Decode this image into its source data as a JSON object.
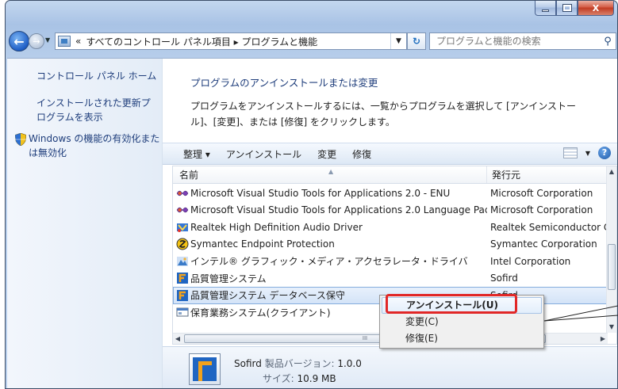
{
  "window": {
    "caption_buttons": {
      "minimize": "",
      "maximize": "",
      "close": "X"
    }
  },
  "nav": {
    "address_chevron": "«",
    "address_path": "すべてのコントロール パネル項目 ▸ プログラムと機能",
    "search_placeholder": "プログラムと機能の検索"
  },
  "left_pane": {
    "links": [
      "コントロール パネル ホーム",
      "インストールされた更新プログラムを表示",
      "Windows の機能の有効化または無効化"
    ]
  },
  "main": {
    "heading": "プログラムのアンインストールまたは変更",
    "description": "プログラムをアンインストールするには、一覧からプログラムを選択して [アンインストール]、[変更]、または [修復] をクリックします。"
  },
  "toolbar": {
    "organize": "整理 ▾",
    "uninstall": "アンインストール",
    "change": "変更",
    "repair": "修復"
  },
  "list": {
    "columns": {
      "name": "名前",
      "publisher": "発行元"
    },
    "rows": [
      {
        "name": "Microsoft Visual Studio Tools for Applications 2.0 - ENU",
        "publisher": "Microsoft Corporation",
        "icon": "vs-icon"
      },
      {
        "name": "Microsoft Visual Studio Tools for Applications 2.0 Language Pac...",
        "publisher": "Microsoft Corporation",
        "icon": "vs-icon"
      },
      {
        "name": "Realtek High Definition Audio Driver",
        "publisher": "Realtek Semiconductor C",
        "icon": "realtek-icon"
      },
      {
        "name": "Symantec Endpoint Protection",
        "publisher": "Symantec Corporation",
        "icon": "symantec-icon"
      },
      {
        "name": "インテル® グラフィック・メディア・アクセラレータ・ドライバ",
        "publisher": "Intel Corporation",
        "icon": "intel-icon"
      },
      {
        "name": "品質管理システム",
        "publisher": "Sofird",
        "icon": "sofird-icon"
      },
      {
        "name": "品質管理システム データベース保守",
        "publisher": "Sofird",
        "icon": "sofird-icon"
      },
      {
        "name": "保育業務システム(クライアント)",
        "publisher": "",
        "icon": "app-window-icon"
      }
    ],
    "hscroll_grip": "III"
  },
  "details": {
    "publisher": "Sofird",
    "version_label": "製品バージョン:",
    "version": "1.0.0",
    "size_label": "サイズ:",
    "size": "10.9 MB"
  },
  "context_menu": {
    "items": [
      "アンインストール(U)",
      "変更(C)",
      "修復(E)"
    ]
  }
}
